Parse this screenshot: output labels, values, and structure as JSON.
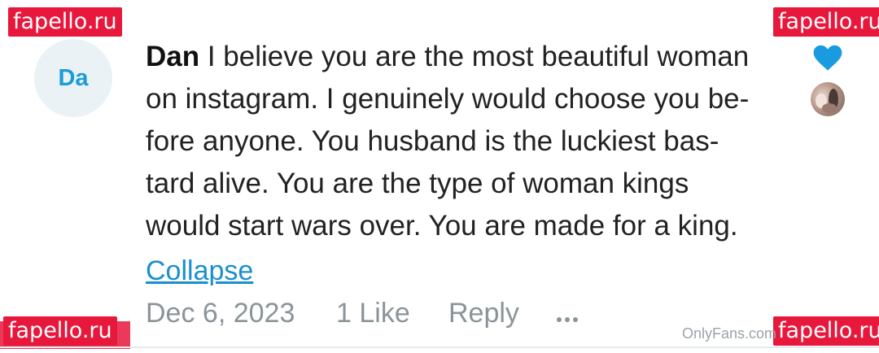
{
  "watermarks": {
    "top_left": "fapello.ru",
    "top_right": "fapello.ru",
    "bottom_left": "fapello.ru",
    "bottom_right": "fapello.ru"
  },
  "comment": {
    "avatar_initials": "Da",
    "author": "Dan",
    "lines": [
      " I believe you are the most beautiful woman",
      "on instagram. I genuinely would choose you be-",
      "fore anyone. You husband is the luckiest bas-",
      "tard alive. You are the type of woman kings",
      "would start wars over. You are made for a king."
    ],
    "collapse_label": "Collapse",
    "date": "Dec 6, 2023",
    "likes": "1 Like",
    "reply_label": "Reply",
    "liked": true
  },
  "footer_watermark": "OnlyFans.com",
  "icons": {
    "heart": "heart-icon",
    "more": "more-dots-icon",
    "liker_avatar": "liker-avatar"
  },
  "colors": {
    "accent": "#1a9cd8",
    "heart": "#1a9be0",
    "muted": "#8a9499",
    "watermark_bg": "#e8183c"
  }
}
